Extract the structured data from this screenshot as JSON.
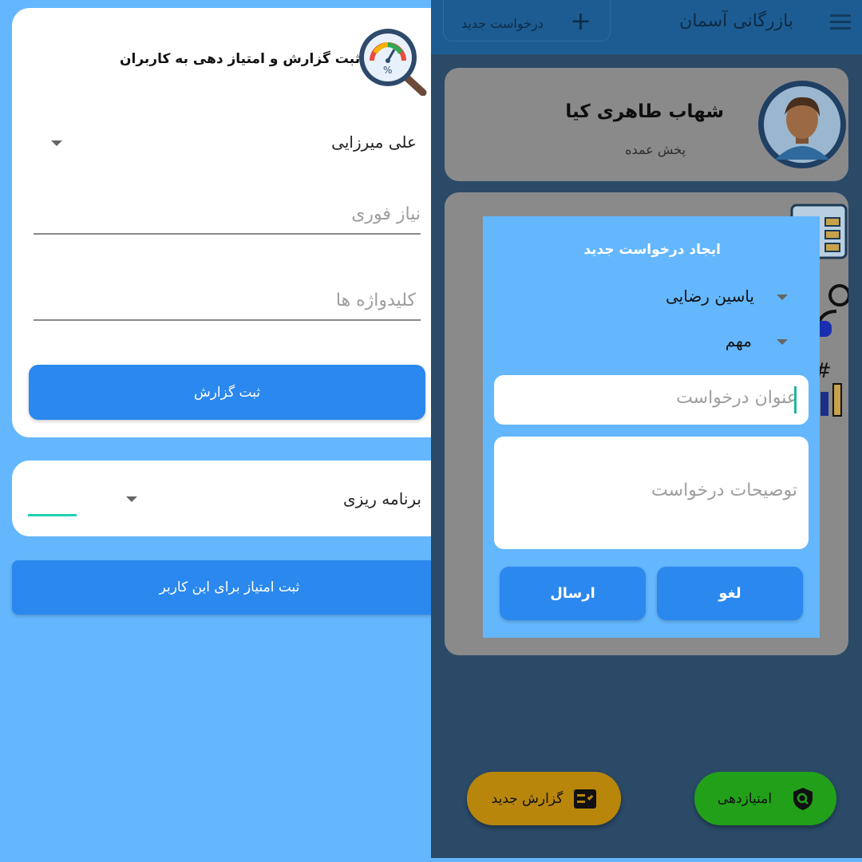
{
  "left": {
    "report_title": "ثبت گزارش و امتیاز دهی به کاربران",
    "user_select": "علی میرزایی",
    "urgent_need_placeholder": "نیاز فوری",
    "keywords_placeholder": "کلیدواژه ها",
    "submit_report_label": "ثبت گزارش",
    "category_select": "برنامه ریزی",
    "submit_score_label": "ثبت امتیاز برای این کاربر"
  },
  "right": {
    "app_title": "بازرگانی آسمان",
    "new_request_label": "درخواست جدید",
    "profile": {
      "name": "شهاب طاهری کیا",
      "role": "پخش عمده"
    },
    "dialog": {
      "title": "ایجاد درخواست جدید",
      "person_select": "یاسین رضایی",
      "priority_select": "مهم",
      "request_title_placeholder": "عنوان درخواست",
      "request_desc_placeholder": "توصیحات درخواست",
      "cancel_label": "لغو",
      "send_label": "ارسال"
    },
    "fab_new_report": "گزارش جدید",
    "fab_scoring": "امتیازدهی"
  },
  "colors": {
    "primary": "#2b88ee",
    "sky": "#64b7fd",
    "appbar": "#1d5c92",
    "fab_report": "#b8860b",
    "fab_scoring": "#22a01a",
    "accent_teal": "#1fd1b5"
  }
}
